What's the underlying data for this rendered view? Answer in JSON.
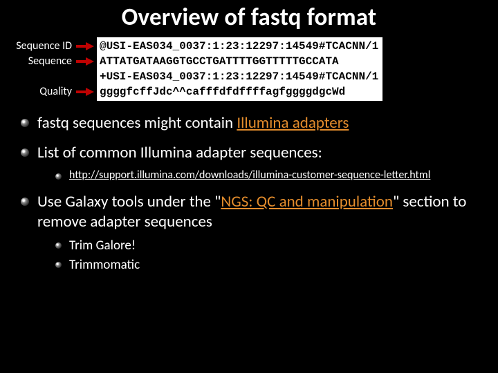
{
  "title": "Overview of fastq format",
  "labels": {
    "seq_id": "Sequence ID",
    "seq": "Sequence",
    "quality": "Quality"
  },
  "fastq": {
    "line1": "@USI-EAS034_0037:1:23:12297:14549#TCACNN/1",
    "line2": "ATTATGATAAGGTGCCTGATTTTGGTTTTTGCCATA",
    "line3": "+USI-EAS034_0037:1:23:12297:14549#TCACNN/1",
    "line4": "ggggfcffJdc^^cafffdfdffffagfggggdgcWd"
  },
  "bullets": {
    "b1_pre": "fastq sequences might contain ",
    "b1_hl": "Illumina adapters",
    "b2": "List of common Illumina adapter sequences:",
    "b2_link": "http://support.illumina.com/downloads/illumina-customer-sequence-letter.html",
    "b3_pre": "Use Galaxy tools under the \"",
    "b3_hl": "NGS: QC and manipulation",
    "b3_post": "\" section to remove adapter sequences",
    "b3_sub1": "Trim Galore!",
    "b3_sub2": "Trimmomatic"
  },
  "colors": {
    "accent": "#e38c2c",
    "arrow": "#bf0202"
  }
}
